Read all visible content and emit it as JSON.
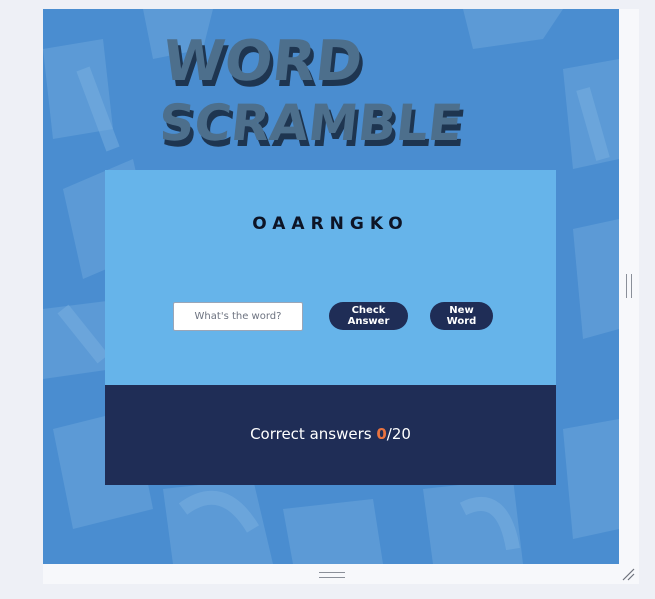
{
  "title": {
    "line1": "WORD",
    "line2": "SCRAMBLE"
  },
  "game": {
    "scrambled_word": "OAARNGKO",
    "input_placeholder": "What's the word?",
    "input_value": "",
    "check_label": "Check Answer",
    "new_word_label": "New Word"
  },
  "score": {
    "prefix": "Correct answers ",
    "correct": "0",
    "separator_total": "/20"
  },
  "colors": {
    "background": "#4a8dd0",
    "card_top": "#66b4ea",
    "card_bottom": "#1f2d56",
    "button": "#1f2d56",
    "score_accent": "#e9733f"
  }
}
